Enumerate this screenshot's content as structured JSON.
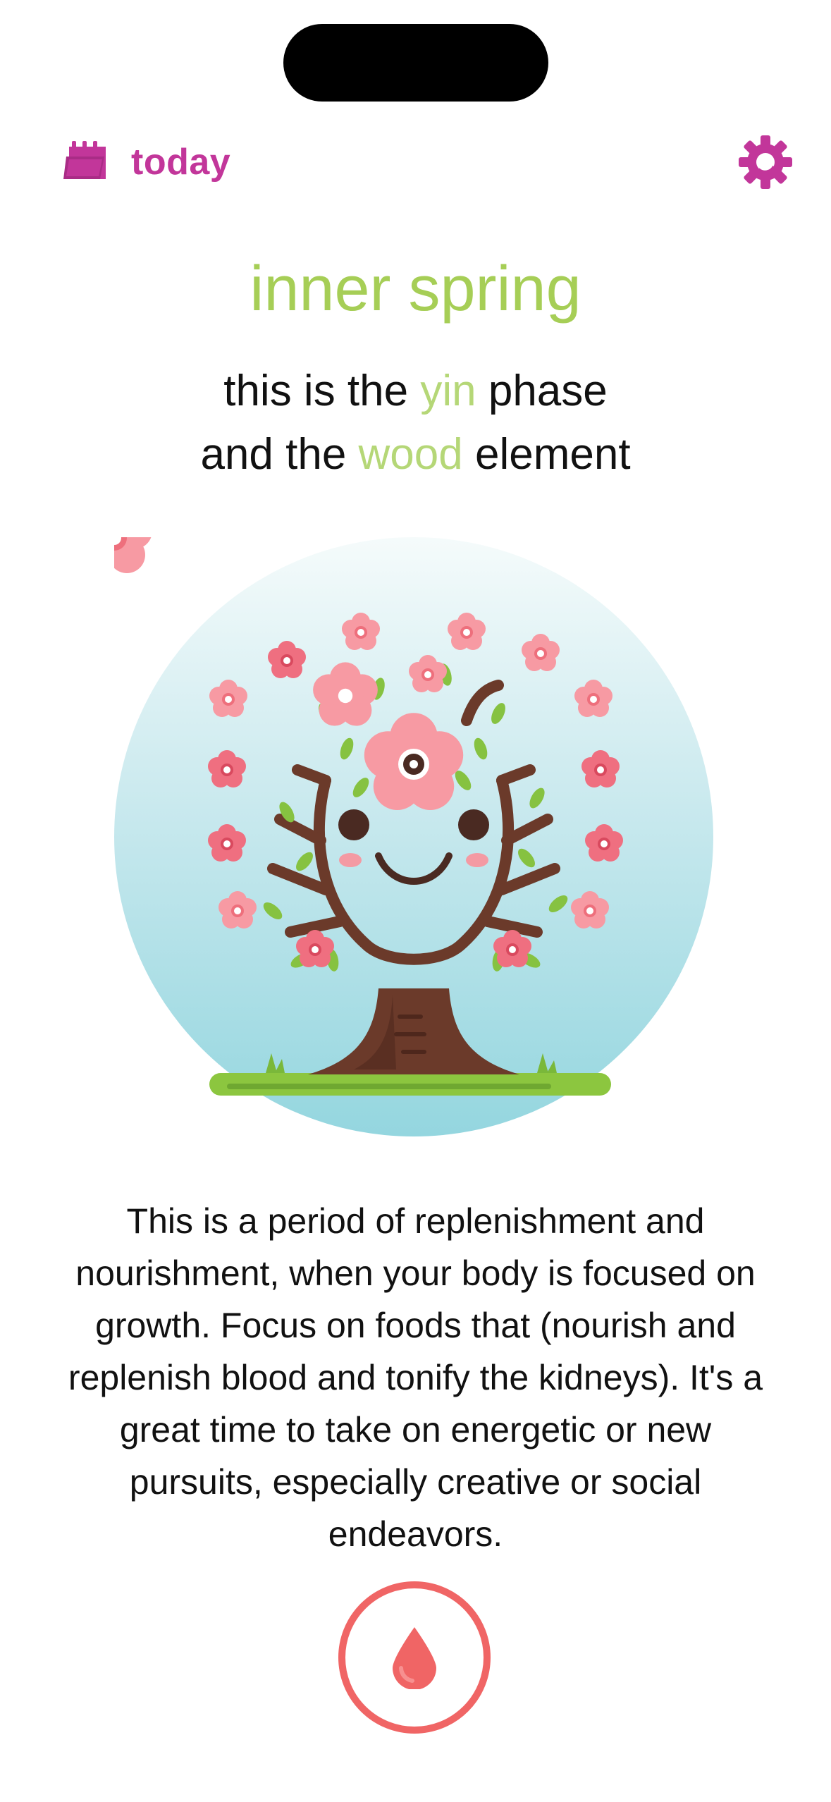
{
  "header": {
    "today_label": "today",
    "today_icon": "calendar-icon",
    "settings_icon": "gear-icon"
  },
  "phase": {
    "title": "inner spring",
    "line1_pre": "this is the ",
    "phase_name": "yin",
    "line1_post": " phase",
    "line2_pre": "and the ",
    "element_name": "wood",
    "line2_post": " element"
  },
  "illustration": {
    "icon": "cherry-blossom-tree-icon"
  },
  "description": "This is a period of replenishment and nourishment, when your body is focused on growth. Focus on foods that (nourish and replenish blood and tonify the kidneys). It's a great time to take on energetic or new pursuits, especially creative or social endeavors.",
  "period_button": {
    "icon": "blood-drop-icon"
  },
  "colors": {
    "accent_magenta": "#c2369a",
    "phase_green": "#a6ce56",
    "highlight_green": "#b5d777",
    "period_red": "#f06565"
  }
}
